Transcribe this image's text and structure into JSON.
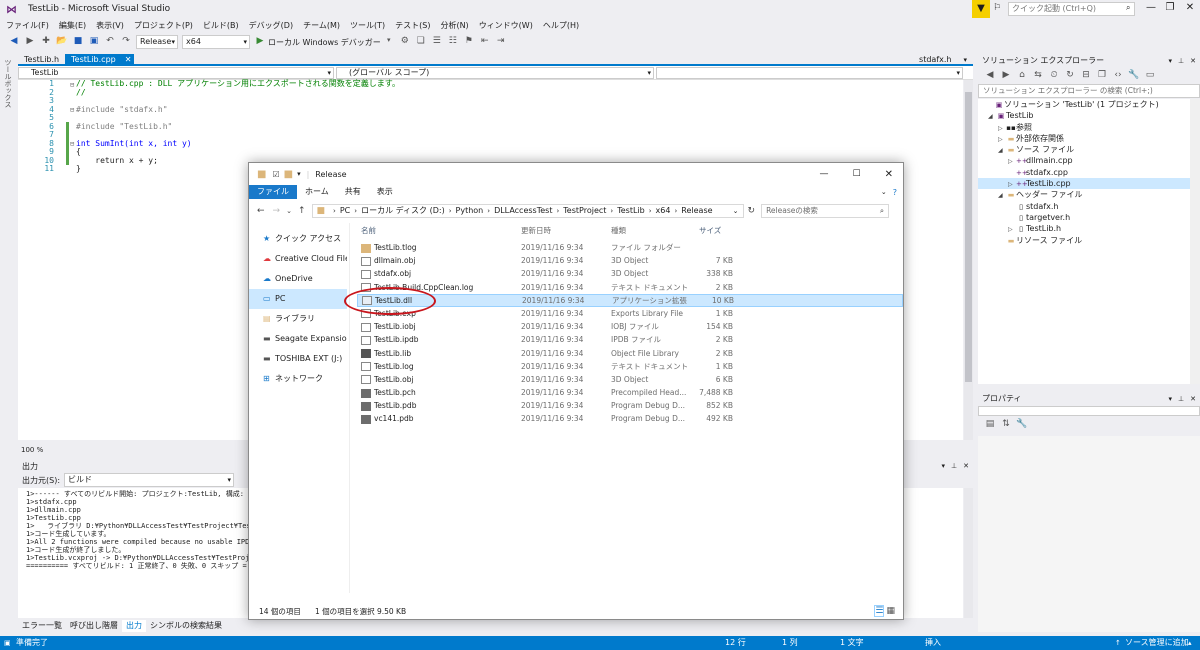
{
  "window": {
    "title": "TestLib - Microsoft Visual Studio",
    "quick_launch_placeholder": "クイック起動 (Ctrl+Q)"
  },
  "menu": [
    "ファイル(F)",
    "編集(E)",
    "表示(V)",
    "プロジェクト(P)",
    "ビルド(B)",
    "デバッグ(D)",
    "チーム(M)",
    "ツール(T)",
    "テスト(S)",
    "分析(N)",
    "ウィンドウ(W)",
    "ヘルプ(H)"
  ],
  "toolbar": {
    "config": "Release",
    "platform": "x64",
    "run_label": "ローカル Windows デバッガー"
  },
  "tool_strip_label": "ツールボックス",
  "editor": {
    "tabs": [
      {
        "label": "TestLib.h",
        "active": false
      },
      {
        "label": "TestLib.cpp",
        "active": true
      }
    ],
    "right_tab": "stdafx.h",
    "nav_project": "TestLib",
    "nav_scope": "(グローバル スコープ)",
    "code_lines": [
      "// TestLib.cpp : DLL アプリケーション用にエクスポートされる関数を定義します。",
      "//",
      "",
      "#include \"stdafx.h\"",
      "",
      "#include \"TestLib.h\"",
      "",
      "int SumInt(int x, int y)",
      "{",
      "    return x + y;",
      "}"
    ],
    "line_numbers": [
      "1",
      "2",
      "3",
      "4",
      "5",
      "6",
      "7",
      "8",
      "9",
      "10",
      "11"
    ],
    "zoom": "100 %"
  },
  "output": {
    "header": "出力",
    "source_label": "出力元(S):",
    "source_value": "ビルド",
    "lines": [
      "1>------ すべてのリビルド開始: プロジェクト:TestLib, 構成: ",
      "1>stdafx.cpp",
      "1>dllmain.cpp",
      "1>TestLib.cpp",
      "1>   ライブラリ D:¥Python¥DLLAccessTest¥TestProject¥TestLib",
      "1>コード生成しています。",
      "1>All 2 functions were compiled because no usable IPDB/IOBJ",
      "1>コード生成が終了しました。",
      "1>TestLib.vcxproj -> D:¥Python¥DLLAccessTest¥TestProject¥Te",
      "========== すべてリビルド: 1 正常終了、0 失敗、0 スキップ ="
    ]
  },
  "bottom_tabs": [
    "エラー一覧",
    "呼び出し階層",
    "出力",
    "シンボルの検索結果"
  ],
  "status": {
    "ready": "準備完了",
    "line": "12 行",
    "col": "1 列",
    "char": "1 文字",
    "mode": "挿入",
    "scm": "ソース管理に追加"
  },
  "solution_explorer": {
    "header": "ソリューション エクスプローラー",
    "search_placeholder": "ソリューション エクスプローラー の検索 (Ctrl+;)",
    "nodes": [
      {
        "label": "ソリューション 'TestLib' (1 プロジェクト)",
        "indent": 0,
        "icon": "solution-icon",
        "arrow": ""
      },
      {
        "label": "TestLib",
        "indent": 1,
        "icon": "project-icon",
        "arrow": "◢"
      },
      {
        "label": "参照",
        "indent": 2,
        "icon": "references-icon",
        "arrow": "▷"
      },
      {
        "label": "外部依存関係",
        "indent": 2,
        "icon": "folder-icon",
        "arrow": "▷"
      },
      {
        "label": "ソース ファイル",
        "indent": 2,
        "icon": "folder-icon",
        "arrow": "◢"
      },
      {
        "label": "dllmain.cpp",
        "indent": 3,
        "icon": "cpp-icon",
        "arrow": "▷"
      },
      {
        "label": "stdafx.cpp",
        "indent": 3,
        "icon": "cpp-icon",
        "arrow": ""
      },
      {
        "label": "TestLib.cpp",
        "indent": 3,
        "icon": "cpp-icon",
        "arrow": "▷",
        "selected": true
      },
      {
        "label": "ヘッダー ファイル",
        "indent": 2,
        "icon": "folder-icon",
        "arrow": "◢"
      },
      {
        "label": "stdafx.h",
        "indent": 3,
        "icon": "header-icon",
        "arrow": ""
      },
      {
        "label": "targetver.h",
        "indent": 3,
        "icon": "header-icon",
        "arrow": ""
      },
      {
        "label": "TestLib.h",
        "indent": 3,
        "icon": "header-icon",
        "arrow": "▷"
      },
      {
        "label": "リソース ファイル",
        "indent": 2,
        "icon": "folder-icon",
        "arrow": ""
      }
    ]
  },
  "properties": {
    "header": "プロパティ"
  },
  "file_explorer": {
    "title": "Release",
    "ribbon_tabs": [
      "ファイル",
      "ホーム",
      "共有",
      "表示"
    ],
    "breadcrumb": [
      "PC",
      "ローカル ディスク (D:)",
      "Python",
      "DLLAccessTest",
      "TestProject",
      "TestLib",
      "x64",
      "Release"
    ],
    "search_placeholder": "Releaseの検索",
    "nav": [
      {
        "label": "クイック アクセス",
        "icon": "star-icon"
      },
      {
        "label": "Creative Cloud Files",
        "icon": "cloud-icon"
      },
      {
        "label": "OneDrive",
        "icon": "onedrive-icon"
      },
      {
        "label": "PC",
        "icon": "pc-icon",
        "selected": true
      },
      {
        "label": "ライブラリ",
        "icon": "library-icon"
      },
      {
        "label": "Seagate Expansion Dr",
        "icon": "drive-icon"
      },
      {
        "label": "TOSHIBA EXT (J:)",
        "icon": "drive-icon"
      },
      {
        "label": "ネットワーク",
        "icon": "network-icon"
      }
    ],
    "columns": [
      "名前",
      "更新日時",
      "種類",
      "サイズ"
    ],
    "files": [
      {
        "name": "TestLib.tlog",
        "date": "2019/11/16 9:34",
        "type": "ファイル フォルダー",
        "size": "",
        "icon": "folder"
      },
      {
        "name": "dllmain.obj",
        "date": "2019/11/16 9:34",
        "type": "3D Object",
        "size": "7 KB",
        "icon": "file"
      },
      {
        "name": "stdafx.obj",
        "date": "2019/11/16 9:34",
        "type": "3D Object",
        "size": "338 KB",
        "icon": "file"
      },
      {
        "name": "TestLib.Build.CppClean.log",
        "date": "2019/11/16 9:34",
        "type": "テキスト ドキュメント",
        "size": "2 KB",
        "icon": "file"
      },
      {
        "name": "TestLib.dll",
        "date": "2019/11/16 9:34",
        "type": "アプリケーション拡張",
        "size": "10 KB",
        "icon": "dll",
        "selected": true
      },
      {
        "name": "TestLib.exp",
        "date": "2019/11/16 9:34",
        "type": "Exports Library File",
        "size": "1 KB",
        "icon": "file"
      },
      {
        "name": "TestLib.iobj",
        "date": "2019/11/16 9:34",
        "type": "IOBJ ファイル",
        "size": "154 KB",
        "icon": "file"
      },
      {
        "name": "TestLib.ipdb",
        "date": "2019/11/16 9:34",
        "type": "IPDB ファイル",
        "size": "2 KB",
        "icon": "file"
      },
      {
        "name": "TestLib.lib",
        "date": "2019/11/16 9:34",
        "type": "Object File Library",
        "size": "2 KB",
        "icon": "lib"
      },
      {
        "name": "TestLib.log",
        "date": "2019/11/16 9:34",
        "type": "テキスト ドキュメント",
        "size": "1 KB",
        "icon": "file"
      },
      {
        "name": "TestLib.obj",
        "date": "2019/11/16 9:34",
        "type": "3D Object",
        "size": "6 KB",
        "icon": "file"
      },
      {
        "name": "TestLib.pch",
        "date": "2019/11/16 9:34",
        "type": "Precompiled Head...",
        "size": "7,488 KB",
        "icon": "pch"
      },
      {
        "name": "TestLib.pdb",
        "date": "2019/11/16 9:34",
        "type": "Program Debug D...",
        "size": "852 KB",
        "icon": "pdb"
      },
      {
        "name": "vc141.pdb",
        "date": "2019/11/16 9:34",
        "type": "Program Debug D...",
        "size": "492 KB",
        "icon": "pdb"
      }
    ],
    "status_count": "14 個の項目",
    "status_selected": "1 個の項目を選択  9.50 KB"
  },
  "colors": {
    "accent": "#007acc",
    "highlight_circle": "#c8161d",
    "selection": "#cce8ff"
  }
}
